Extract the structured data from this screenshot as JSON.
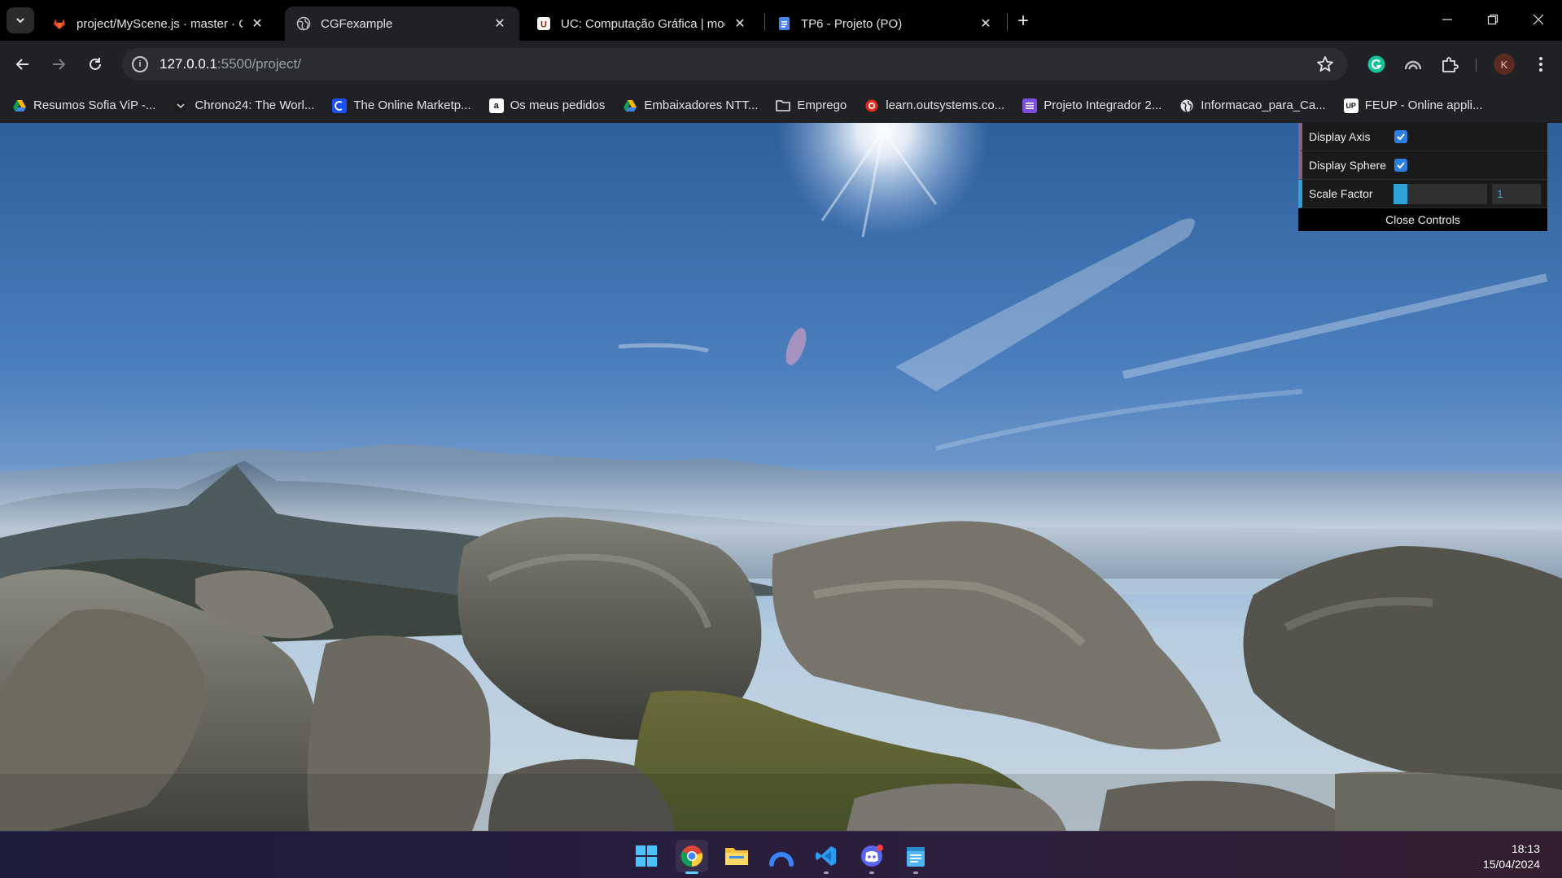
{
  "browser": {
    "tabs": [
      {
        "title": "project/MyScene.js · master · C",
        "icon": "gitlab-icon",
        "active": false
      },
      {
        "title": "CGFexample",
        "icon": "globe-icon",
        "active": true
      },
      {
        "title": "UC: Computação Gráfica | mood",
        "icon": "moodle-icon",
        "active": false
      },
      {
        "title": "TP6 - Projeto (PO)",
        "icon": "google-docs-icon",
        "active": false
      }
    ],
    "close_glyph": "✕",
    "new_tab_glyph": "+",
    "address": {
      "host": "127.0.0.1",
      "rest": ":5500/project/"
    },
    "profile_initial": "K",
    "bookmarks": [
      {
        "label": "Resumos Sofia ViP -...",
        "icon": "google-drive-icon"
      },
      {
        "label": "Chrono24: The Worl...",
        "icon": "chrono24-icon"
      },
      {
        "label": "The Online Marketp...",
        "icon": "marketplace-icon"
      },
      {
        "label": "Os meus pedidos",
        "icon": "amazon-icon"
      },
      {
        "label": "Embaixadores NTT...",
        "icon": "google-drive-icon"
      },
      {
        "label": "Emprego",
        "icon": "folder-icon"
      },
      {
        "label": "learn.outsystems.co...",
        "icon": "outsystems-icon"
      },
      {
        "label": "Projeto Integrador 2...",
        "icon": "list-icon"
      },
      {
        "label": "Informacao_para_Ca...",
        "icon": "globe-icon"
      },
      {
        "label": "FEUP - Online appli...",
        "icon": "feup-icon"
      }
    ]
  },
  "gui": {
    "display_axis": {
      "label": "Display Axis",
      "checked": true
    },
    "display_sphere": {
      "label": "Display Sphere",
      "checked": true
    },
    "scale_factor": {
      "label": "Scale Factor",
      "value": "1",
      "fraction": 0.15
    },
    "close_label": "Close Controls"
  },
  "taskbar": {
    "apps": [
      "windows-start-icon",
      "chrome-icon",
      "file-explorer-icon",
      "arc-icon",
      "vscode-icon",
      "discord-icon",
      "notepad-icon"
    ],
    "time": "18:13",
    "date": "15/04/2024"
  },
  "colors": {
    "accent_blue": "#2fa1d6",
    "bool_border": "#806787",
    "checkbox_blue": "#2b7fe0"
  }
}
